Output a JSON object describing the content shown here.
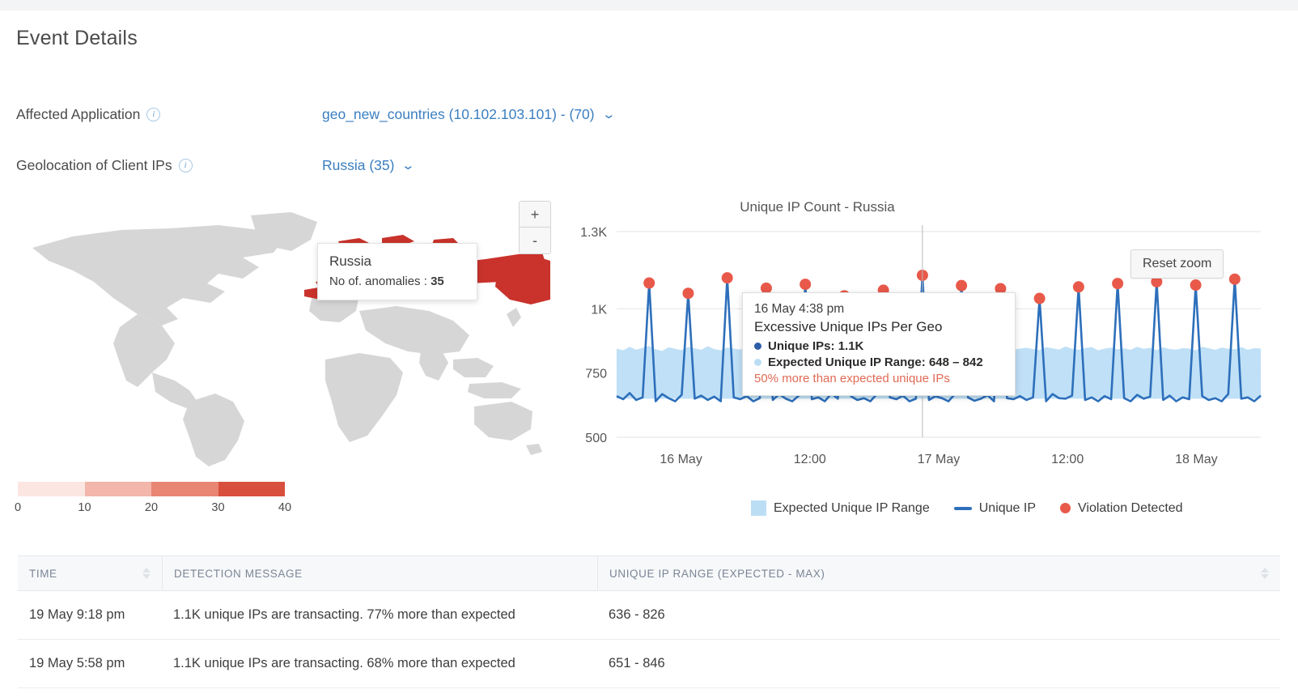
{
  "header": {
    "title": "Event Details",
    "fields": [
      {
        "label": "Affected Application",
        "info_icon": "info-icon",
        "value": "geo_new_countries (10.102.103.101) - (70)",
        "chevron": "chevron-down-icon"
      },
      {
        "label": "Geolocation of Client IPs",
        "info_icon": "info-icon",
        "value": "Russia (35)",
        "chevron": "chevron-down-icon"
      }
    ]
  },
  "map": {
    "zoom_in_label": "+",
    "zoom_out_label": "-",
    "tooltip": {
      "country": "Russia",
      "anomalies_label": "No of. anomalies :",
      "anomalies_value": "35"
    },
    "highlight_country": "Russia",
    "base_country_color": "#d6d6d6",
    "highlight_color": "#c9332c",
    "scale": {
      "ticks": [
        "0",
        "10",
        "20",
        "30",
        "40"
      ],
      "colors": [
        "#fbe6e1",
        "#f2b6aa",
        "#e88573",
        "#d94f3d"
      ]
    }
  },
  "chart": {
    "title": "Unique IP Count - Russia",
    "reset_zoom_label": "Reset zoom",
    "tooltip": {
      "time": "16 May 4:38 pm",
      "heading": "Excessive Unique IPs Per Geo",
      "unique_ips_label": "Unique IPs:",
      "unique_ips_value": "1.1K",
      "expected_range_label": "Expected Unique IP Range:",
      "expected_range_value": "648 – 842",
      "note": "50% more than expected unique IPs"
    },
    "legend": [
      {
        "label": "Expected Unique IP Range",
        "type": "area",
        "color": "#bcdef5"
      },
      {
        "label": "Unique IP",
        "type": "line",
        "color": "#2d6fbb"
      },
      {
        "label": "Violation Detected",
        "type": "dot",
        "color": "#e8594a"
      }
    ]
  },
  "chart_data": {
    "type": "line",
    "title": "Unique IP Count - Russia",
    "xlabel": "",
    "ylabel": "",
    "ylim": [
      500,
      1300
    ],
    "ytick_labels": [
      "1.3K",
      "1K",
      "750",
      "500"
    ],
    "ytick_values": [
      1300,
      1000,
      750,
      500
    ],
    "xtick_labels": [
      "16 May",
      "12:00",
      "17 May",
      "12:00",
      "18 May"
    ],
    "grid": true,
    "legend_position": "bottom",
    "series": [
      {
        "name": "Unique IP",
        "type": "line",
        "color": "#2d6fbb",
        "values": [
          660,
          648,
          672,
          645,
          655,
          1100,
          640,
          668,
          652,
          640,
          665,
          1060,
          650,
          662,
          645,
          658,
          640,
          1120,
          655,
          648,
          660,
          640,
          652,
          1080,
          645,
          668,
          650,
          640,
          662,
          1095,
          648,
          655,
          640,
          670,
          650,
          1050,
          660,
          645,
          652,
          640,
          668,
          1072,
          655,
          648,
          662,
          640,
          650,
          1130,
          645,
          660,
          652,
          640,
          668,
          1090,
          655,
          642,
          650,
          664,
          640,
          1078,
          652,
          648,
          660,
          645,
          655,
          1040,
          640,
          668,
          652,
          650,
          662,
          1085,
          645,
          655,
          640,
          660,
          648,
          1098,
          652,
          640,
          665,
          650,
          658,
          1105,
          645,
          662,
          640,
          655,
          648,
          1092,
          660,
          645,
          652,
          640,
          668,
          1115,
          650,
          655,
          640,
          662
        ]
      },
      {
        "name": "Expected Unique IP Range",
        "type": "band",
        "color": "#bcdef5",
        "lower": 650,
        "upper_values": [
          845,
          838,
          852,
          840,
          848,
          855,
          842,
          836,
          850,
          844,
          839,
          851,
          846,
          840,
          854,
          843,
          838,
          849,
          845,
          841,
          853,
          840,
          847,
          850,
          842,
          838,
          852,
          846,
          840,
          848,
          844,
          851,
          839,
          845,
          853,
          841,
          847,
          840,
          849,
          843,
          838,
          852,
          846,
          844,
          840,
          850,
          842,
          848,
          839,
          853,
          845,
          841,
          847,
          840,
          851,
          844,
          838,
          849,
          846,
          842,
          852,
          840,
          845,
          848,
          843,
          839,
          850,
          846,
          841,
          853,
          844,
          840,
          847,
          851,
          838,
          845,
          849,
          842,
          846,
          840,
          852,
          844,
          848,
          839,
          850,
          843,
          841,
          847,
          845,
          838,
          852,
          846,
          840,
          849,
          844,
          842,
          851,
          840,
          847,
          845
        ]
      }
    ],
    "violations": {
      "name": "Violation Detected",
      "color": "#e8594a",
      "points": [
        {
          "x": 5,
          "y": 1100
        },
        {
          "x": 11,
          "y": 1060
        },
        {
          "x": 17,
          "y": 1120
        },
        {
          "x": 23,
          "y": 1080
        },
        {
          "x": 29,
          "y": 1095
        },
        {
          "x": 35,
          "y": 1050
        },
        {
          "x": 41,
          "y": 1072
        },
        {
          "x": 47,
          "y": 1130
        },
        {
          "x": 53,
          "y": 1090
        },
        {
          "x": 59,
          "y": 1078
        },
        {
          "x": 65,
          "y": 1040
        },
        {
          "x": 71,
          "y": 1085
        },
        {
          "x": 77,
          "y": 1098
        },
        {
          "x": 83,
          "y": 1105
        },
        {
          "x": 89,
          "y": 1092
        },
        {
          "x": 95,
          "y": 1115
        }
      ]
    },
    "annotation": {
      "time": "16 May 4:38 pm",
      "heading": "Excessive Unique IPs Per Geo",
      "unique_ips": "1.1K",
      "expected_range": "648 – 842",
      "note": "50% more than expected unique IPs"
    }
  },
  "table": {
    "columns": [
      {
        "label": "TIME",
        "sortable": true
      },
      {
        "label": "DETECTION MESSAGE",
        "sortable": false
      },
      {
        "label": "UNIQUE IP RANGE (EXPECTED - MAX)",
        "sortable": true
      }
    ],
    "rows": [
      {
        "time": "19 May 9:18 pm",
        "message": "1.1K unique IPs are transacting. 77% more than expected",
        "range": "636 - 826"
      },
      {
        "time": "19 May 5:58 pm",
        "message": "1.1K unique IPs are transacting. 68% more than expected",
        "range": "651 - 846"
      }
    ]
  }
}
